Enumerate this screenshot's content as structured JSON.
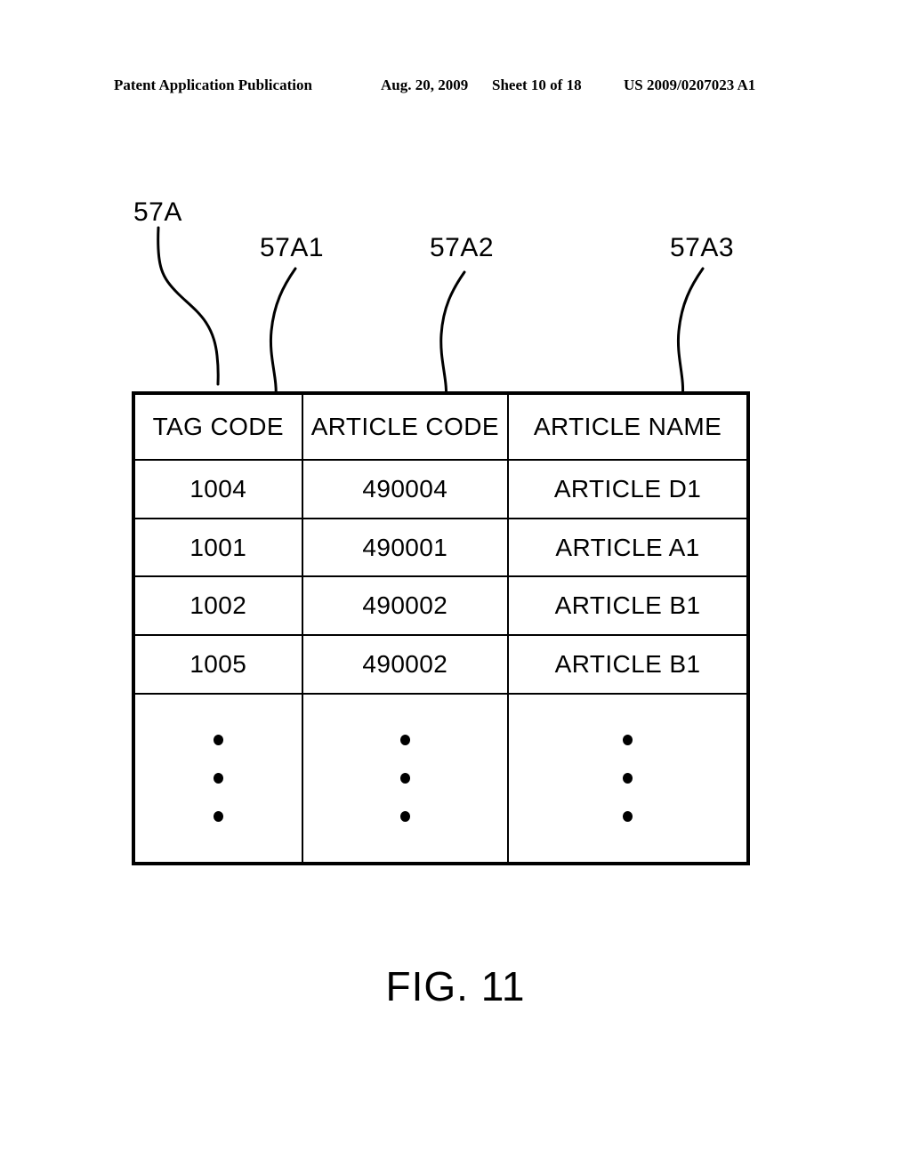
{
  "page_header": {
    "publication": "Patent Application Publication",
    "date": "Aug. 20, 2009",
    "sheet": "Sheet 10 of 18",
    "patent_number": "US 2009/0207023 A1"
  },
  "reference_labels": {
    "table": "57A",
    "column_1": "57A1",
    "column_2": "57A2",
    "column_3": "57A3"
  },
  "table": {
    "headers": [
      "TAG CODE",
      "ARTICLE CODE",
      "ARTICLE NAME"
    ],
    "rows": [
      [
        "1004",
        "490004",
        "ARTICLE D1"
      ],
      [
        "1001",
        "490001",
        "ARTICLE A1"
      ],
      [
        "1002",
        "490002",
        "ARTICLE B1"
      ],
      [
        "1005",
        "490002",
        "ARTICLE B1"
      ]
    ],
    "continuation_row": [
      "⋮",
      "⋮",
      "⋮"
    ]
  },
  "figure": {
    "caption": "FIG. 11"
  },
  "colors": {
    "ink": "#000000",
    "paper": "#ffffff"
  }
}
